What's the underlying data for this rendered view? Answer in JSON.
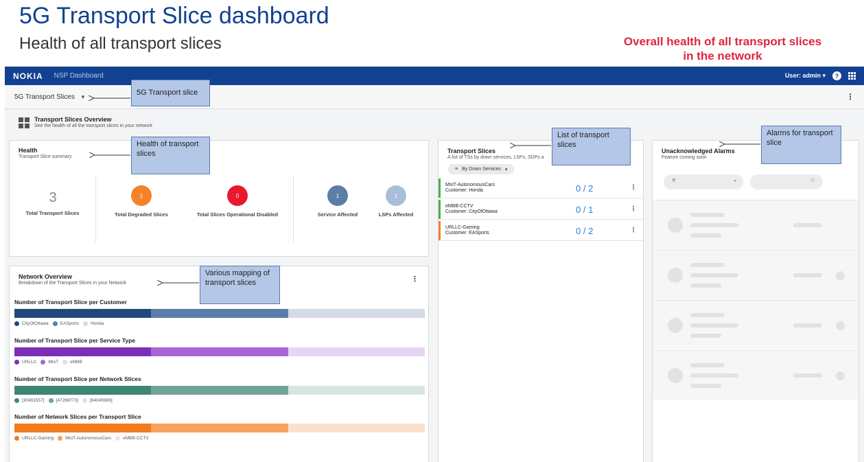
{
  "slide": {
    "title": "5G Transport Slice dashboard",
    "subtitle": "Health of all transport slices",
    "red_callout": "Overall health of all transport slices in the network"
  },
  "topbar": {
    "logo": "NOKIA",
    "app": "NSP Dashboard",
    "user": "User: admin",
    "help": "?"
  },
  "subbar": {
    "selector": "5G Transport Slices"
  },
  "overview": {
    "title": "Transport Slices Overview",
    "subtitle": "See the health of all the transport slices in your network"
  },
  "health": {
    "title": "Health",
    "subtitle": "Transport Slice summary",
    "total_value": "3",
    "total_label": "Total Transport Slices",
    "metrics": [
      {
        "value": "1",
        "label": "Total Degraded Slices",
        "color": "#f5822a"
      },
      {
        "value": "0",
        "label": "Total Slices Operational Disabled",
        "color": "#e8192c"
      },
      {
        "value": "1",
        "label": "Service Affected",
        "color": "#5b7ea6"
      },
      {
        "value": "1",
        "label": "LSPs Affected",
        "color": "#a9bfd9"
      }
    ]
  },
  "network_overview": {
    "title": "Network Overview",
    "subtitle": "Breakdown of the Transport Slices in your Network",
    "bars": [
      {
        "title": "Number of Transport Slice per Customer",
        "segments": [
          {
            "label": "CityOfOttawa",
            "color": "#1f497d"
          },
          {
            "label": "EASports",
            "color": "#5a7ca8"
          },
          {
            "label": "Honda",
            "color": "#d3dbe7"
          }
        ]
      },
      {
        "title": "Number of Transport Slice per Service Type",
        "segments": [
          {
            "label": "URLLC",
            "color": "#7b2fb6"
          },
          {
            "label": "MIoT",
            "color": "#a866d6"
          },
          {
            "label": "eMBB",
            "color": "#e6d6f2"
          }
        ]
      },
      {
        "title": "Number of Transport Slice per Network Slices",
        "segments": [
          {
            "label": "[30491557]",
            "color": "#3f8575"
          },
          {
            "label": "[47268773]",
            "color": "#6fa598"
          },
          {
            "label": "[64045989]",
            "color": "#d8e4e1"
          }
        ]
      },
      {
        "title": "Number of Network Slices per Transport Slice",
        "segments": [
          {
            "label": "URLLC-Gaming",
            "color": "#f47b20"
          },
          {
            "label": "MIoT-AutonomousCars",
            "color": "#f7a060"
          },
          {
            "label": "eMBB-CCTV",
            "color": "#fbe1cd"
          }
        ]
      }
    ]
  },
  "transport_slices": {
    "title": "Transport Slices",
    "subtitle": "A list of TSs by down services, LSPs, SDPs a",
    "filter": "By Down Services",
    "rows": [
      {
        "name": "MIoT-AutonomousCars",
        "customer": "Customer: Honda",
        "ratio": "0 / 2",
        "accent": "#4caf50"
      },
      {
        "name": "eMBB-CCTV",
        "customer": "Customer: CityOfOttawa",
        "ratio": "0 / 1",
        "accent": "#4caf50"
      },
      {
        "name": "URLLC-Gaming",
        "customer": "Customer: EASports",
        "ratio": "0 / 2",
        "accent": "#f5822a"
      }
    ]
  },
  "alarms": {
    "title": "Unacknowledged Alarms",
    "subtitle": "Feature coming soon"
  },
  "callouts": {
    "transport_slice": "5G Transport slice",
    "health": "Health of transport slices",
    "list": "List of transport slices",
    "alarms": "Alarms for transport slice",
    "mapping": "Various mapping of transport slices"
  }
}
